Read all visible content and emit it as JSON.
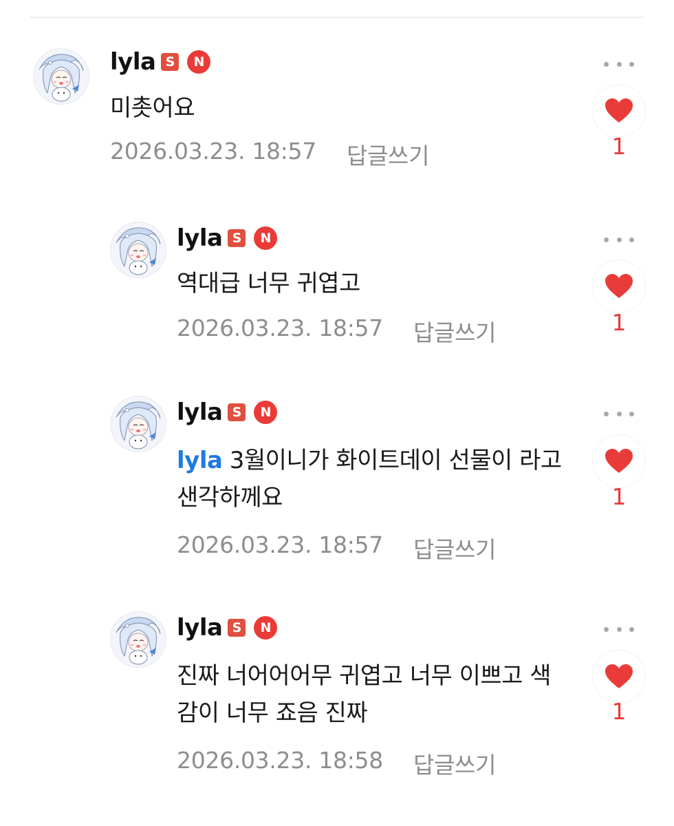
{
  "comments": [
    {
      "nickname": "lyla",
      "badge_s": "S",
      "badge_n": "N",
      "mention": "",
      "text": "미촛어요",
      "date": "2026.03.23. 18:57",
      "reply_label": "답글쓰기",
      "likes": "1"
    },
    {
      "nickname": "lyla",
      "badge_s": "S",
      "badge_n": "N",
      "mention": "",
      "text": "역대급 너무 귀엽고",
      "date": "2026.03.23. 18:57",
      "reply_label": "답글쓰기",
      "likes": "1"
    },
    {
      "nickname": "lyla",
      "badge_s": "S",
      "badge_n": "N",
      "mention": "lyla",
      "text": "3월이니가 화이트데이 선물이 라고 샌각하께요",
      "date": "2026.03.23. 18:57",
      "reply_label": "답글쓰기",
      "likes": "1"
    },
    {
      "nickname": "lyla",
      "badge_s": "S",
      "badge_n": "N",
      "mention": "",
      "text": "진짜 너어어어무 귀엽고 너무 이쁘고 색감이 너무 죠음 진짜",
      "date": "2026.03.23. 18:58",
      "reply_label": "답글쓰기",
      "likes": "1"
    }
  ],
  "icons": {
    "more": "more-dots-icon",
    "like": "heart-icon",
    "avatar": "anime-character-avatar"
  },
  "colors": {
    "heart": "#ea3b3b",
    "mention": "#1f7ae0",
    "badge_s": "#e04f3f",
    "badge_n": "#ea3b37",
    "meta": "#8d8d8d"
  }
}
